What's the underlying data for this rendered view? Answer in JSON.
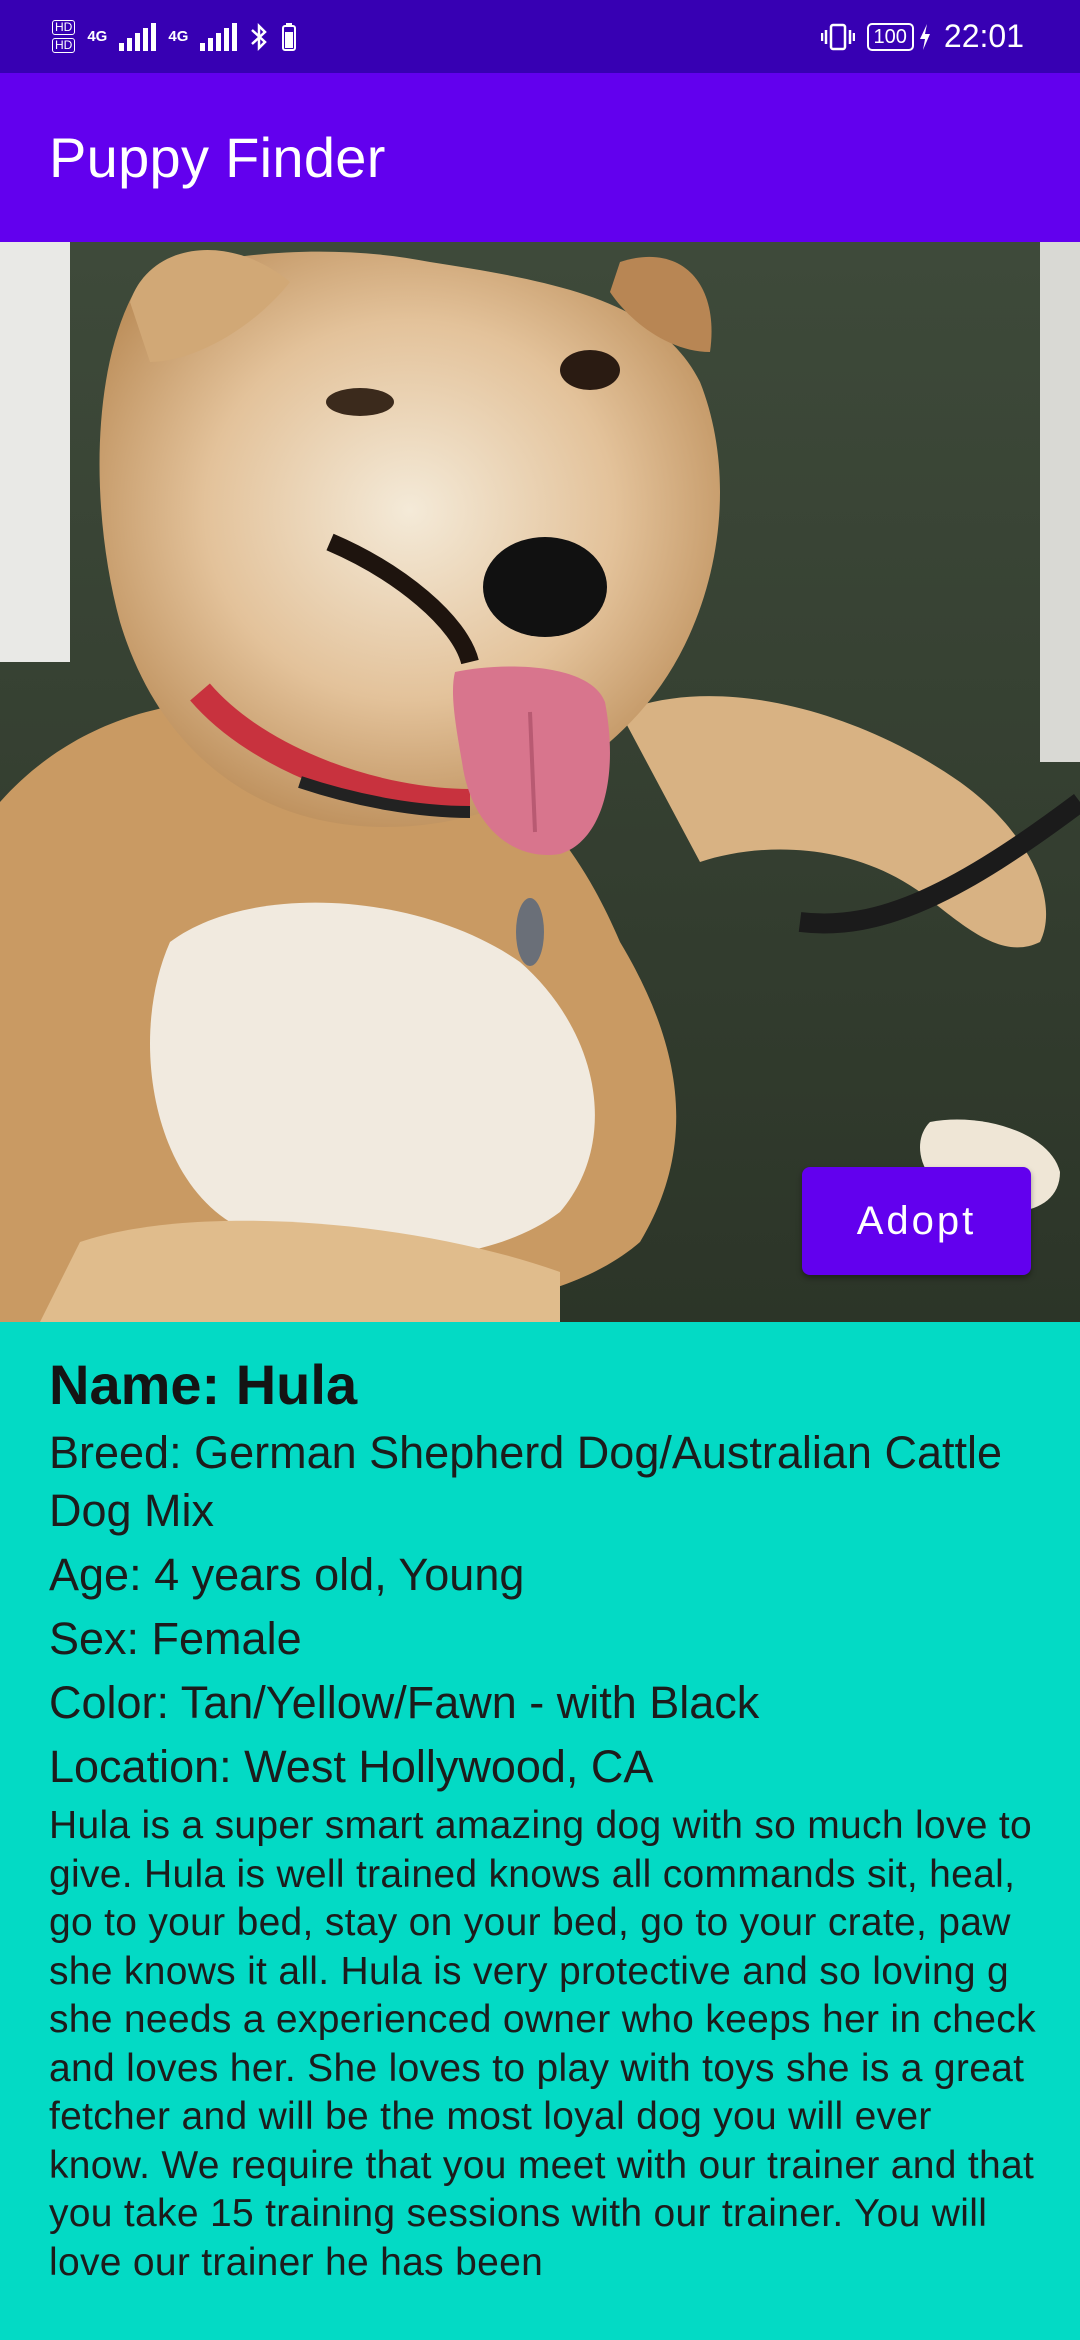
{
  "status_bar": {
    "hd1": "HD",
    "hd2": "HD",
    "net1": "4G",
    "net2": "4G",
    "battery": "100",
    "time": "22:01"
  },
  "app_bar": {
    "title": "Puppy Finder"
  },
  "photo": {
    "subject": "dog-photo"
  },
  "adopt_button": {
    "label": "Adopt"
  },
  "details": {
    "name": "Name: Hula",
    "breed": "Breed: German Shepherd Dog/Australian Cattle Dog Mix",
    "age": "Age: 4 years old, Young",
    "sex": "Sex: Female",
    "color": "Color: Tan/Yellow/Fawn - with Black",
    "location": "Location: West Hollywood, CA",
    "description": "Hula is a super smart amazing dog with so much love to give. Hula is well trained knows all commands sit, heal, go to your bed, stay on your bed, go to your crate, paw she knows it all. Hula is very protective and so loving g she needs a experienced owner who keeps her in check and loves her. She loves to play with toys she is a great fetcher and will be the most loyal dog you will ever know. We require that you meet with our trainer and that you take 15 training sessions with our trainer. You will love our trainer he has been"
  },
  "colors": {
    "status_bar": "#3700b3",
    "app_bar": "#6200ee",
    "button": "#6200ee",
    "details_background": "#03dac5"
  }
}
